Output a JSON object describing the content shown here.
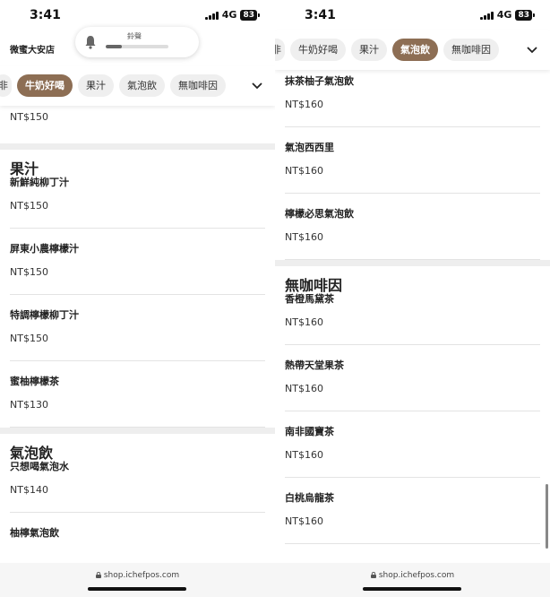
{
  "status": {
    "time": "3:41",
    "network": "4G",
    "battery": "83"
  },
  "shop_name": "微蜜大安店",
  "notification": {
    "title": "鈴聲",
    "progress": 0.25
  },
  "url": "shop.ichefpos.com",
  "left": {
    "tabs": [
      {
        "label": "非",
        "active": false,
        "cut": true
      },
      {
        "label": "牛奶好喝",
        "active": true
      },
      {
        "label": "果汁",
        "active": false
      },
      {
        "label": "氣泡飲",
        "active": false
      },
      {
        "label": "無咖啡因",
        "active": false
      }
    ],
    "top_price": "NT$150",
    "sections": [
      {
        "title": "果汁",
        "items": [
          {
            "name": "新鮮純柳丁汁",
            "price": "NT$150"
          },
          {
            "name": "屏東小農檸檬汁",
            "price": "NT$150"
          },
          {
            "name": "特調檸檬柳丁汁",
            "price": "NT$150"
          },
          {
            "name": "蜜柚檸檬茶",
            "price": "NT$130"
          }
        ]
      },
      {
        "title": "氣泡飲",
        "items": [
          {
            "name": "只想喝氣泡水",
            "price": "NT$140"
          },
          {
            "name": "柚檸氣泡飲",
            "price": ""
          }
        ]
      }
    ]
  },
  "right": {
    "tabs": [
      {
        "label": "非",
        "active": false,
        "cut": true
      },
      {
        "label": "牛奶好喝",
        "active": false
      },
      {
        "label": "果汁",
        "active": false
      },
      {
        "label": "氣泡飲",
        "active": true
      },
      {
        "label": "無咖啡因",
        "active": false
      }
    ],
    "top_items": [
      {
        "name": "抹茶柚子氣泡飲",
        "price": "NT$160"
      },
      {
        "name": "氣泡西西里",
        "price": "NT$160"
      },
      {
        "name": "檸檬必思氣泡飲",
        "price": "NT$160"
      }
    ],
    "sections": [
      {
        "title": "無咖啡因",
        "items": [
          {
            "name": "香橙馬黛茶",
            "price": "NT$160"
          },
          {
            "name": "熱帶天堂果茶",
            "price": "NT$160"
          },
          {
            "name": "南非國寶茶",
            "price": "NT$160"
          },
          {
            "name": "白桃烏龍茶",
            "price": "NT$160"
          }
        ]
      }
    ]
  }
}
